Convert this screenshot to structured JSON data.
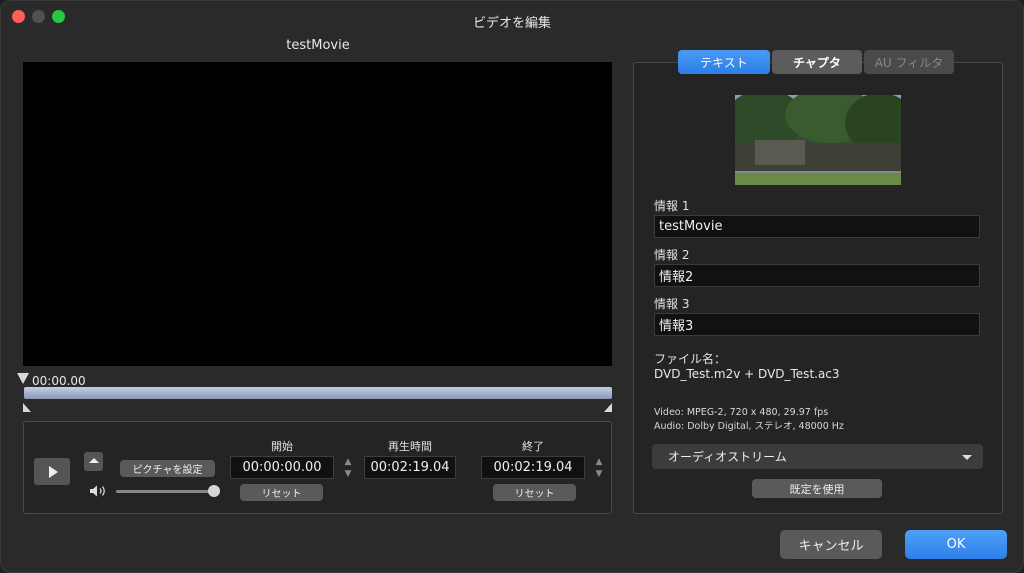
{
  "window": {
    "title": "ビデオを編集"
  },
  "movie": {
    "title": "testMovie"
  },
  "timeline": {
    "current_time": "00:00.00"
  },
  "controls": {
    "picture_button": "ピクチャを設定",
    "start_label": "開始",
    "start_value": "00:00:00.00",
    "duration_label": "再生時間",
    "duration_value": "00:02:19.04",
    "end_label": "終了",
    "end_value": "00:02:19.04",
    "reset_label": "リセット",
    "volume": 1.0
  },
  "tabs": [
    {
      "label": "テキスト",
      "selected": true
    },
    {
      "label": "チャプタ",
      "selected": false
    },
    {
      "label": "AU フィルタ",
      "selected": false,
      "disabled": true
    }
  ],
  "info": [
    {
      "label": "情報 1",
      "value": "testMovie"
    },
    {
      "label": "情報 2",
      "value": "情報2"
    },
    {
      "label": "情報 3",
      "value": "情報3"
    }
  ],
  "file": {
    "label": "ファイル名：",
    "name": "DVD_Test.m2v + DVD_Test.ac3",
    "video": "Video: MPEG-2, 720 x 480, 29.97 fps",
    "audio": "Audio: Dolby Digital, ステレオ, 48000 Hz"
  },
  "audio_stream": {
    "selected": "オーディオストリーム"
  },
  "buttons": {
    "use_default": "既定を使用",
    "cancel": "キャンセル",
    "ok": "OK"
  },
  "icons": {
    "play": "play-icon",
    "eject": "eject-icon",
    "speaker": "speaker-icon",
    "chevron": "chevron-down-icon"
  },
  "colors": {
    "accent": "#2d7ee6",
    "window_bg": "#2a2a2a",
    "field_bg": "#111111"
  }
}
